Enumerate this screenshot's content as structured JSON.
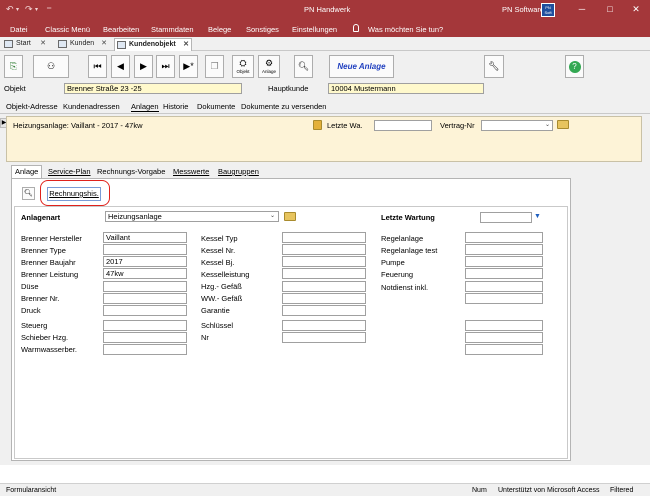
{
  "titlebar": {
    "app_title": "PN Handwerk",
    "account": "PN Software",
    "avatar_text": "PN Soft"
  },
  "ribbon": {
    "items": [
      "Datei",
      "Classic Menü",
      "Bearbeiten",
      "Stammdaten",
      "Belege",
      "Sonstiges",
      "Einstellungen"
    ],
    "search": "Was möchten Sie tun?"
  },
  "doc_tabs": [
    "Start",
    "Kunden",
    "Kundenobjekt"
  ],
  "toolbar": {
    "objekt_label": "Objekt",
    "anlage_label": "Anlage",
    "neue_anlage": "Neue Anlage"
  },
  "header": {
    "objekt_label": "Objekt",
    "objekt_value": "Brenner Straße 23 -25",
    "hauptkunde_label": "Hauptkunde",
    "hauptkunde_value": "10004 Mustermann"
  },
  "nav": [
    "Objekt-Adresse",
    "Kundenadressen",
    "Anlagen",
    "Historie",
    "Dokumente",
    "Dokumente zu versenden"
  ],
  "panel": {
    "anlage_title": "Heizungsanlage: Vaillant  - 2017 - 47kw",
    "letzte_wa_label": "Letzte Wa.",
    "letzte_wa_value": "",
    "vertrag_label": "Vertrag-Nr",
    "vertrag_value": ""
  },
  "sub_tabs": [
    "Anlage",
    "Service-Plan",
    "Rechnungs-Vorgabe",
    "Messwerte",
    "Baugruppen"
  ],
  "rechnungshis_button": "Rechnungshis.",
  "form": {
    "anlagenart_label": "Anlagenart",
    "anlagenart_value": "Heizungsanlage",
    "letzte_wartung_label": "Letzte Wartung",
    "letzte_wartung_value": "",
    "col1": [
      {
        "label": "Brenner Hersteller",
        "value": "Vaillant"
      },
      {
        "label": "Brenner Type",
        "value": ""
      },
      {
        "label": "Brenner Baujahr",
        "value": "2017"
      },
      {
        "label": "Brenner Leistung",
        "value": "47kw"
      },
      {
        "label": "Düse",
        "value": ""
      },
      {
        "label": "Brenner Nr.",
        "value": ""
      },
      {
        "label": "Druck",
        "value": ""
      },
      {
        "label": "Steuerg",
        "value": ""
      },
      {
        "label": "Schieber Hzg.",
        "value": ""
      },
      {
        "label": "Warmwasserber.",
        "value": ""
      }
    ],
    "col2": [
      {
        "label": "Kessel Typ",
        "value": ""
      },
      {
        "label": "Kessel Nr.",
        "value": ""
      },
      {
        "label": "Kessel Bj.",
        "value": ""
      },
      {
        "label": "Kesselleistung",
        "value": ""
      },
      {
        "label": "Hzg.- Gefäß",
        "value": ""
      },
      {
        "label": "WW.- Gefäß",
        "value": ""
      },
      {
        "label": "Garantie",
        "value": ""
      },
      {
        "label": "Schlüssel",
        "value": ""
      },
      {
        "label": "Nr",
        "value": ""
      }
    ],
    "col3": [
      {
        "label": "Regelanlage",
        "value": ""
      },
      {
        "label": "Regelanlage test",
        "value": ""
      },
      {
        "label": "Pumpe",
        "value": ""
      },
      {
        "label": "Feuerung",
        "value": ""
      },
      {
        "label": "Notdienst inkl.",
        "value": ""
      }
    ]
  },
  "statusbar": {
    "left": "Formularansicht",
    "num": "Num",
    "support": "Unterstützt von Microsoft Access",
    "filtered": "Filtered"
  }
}
